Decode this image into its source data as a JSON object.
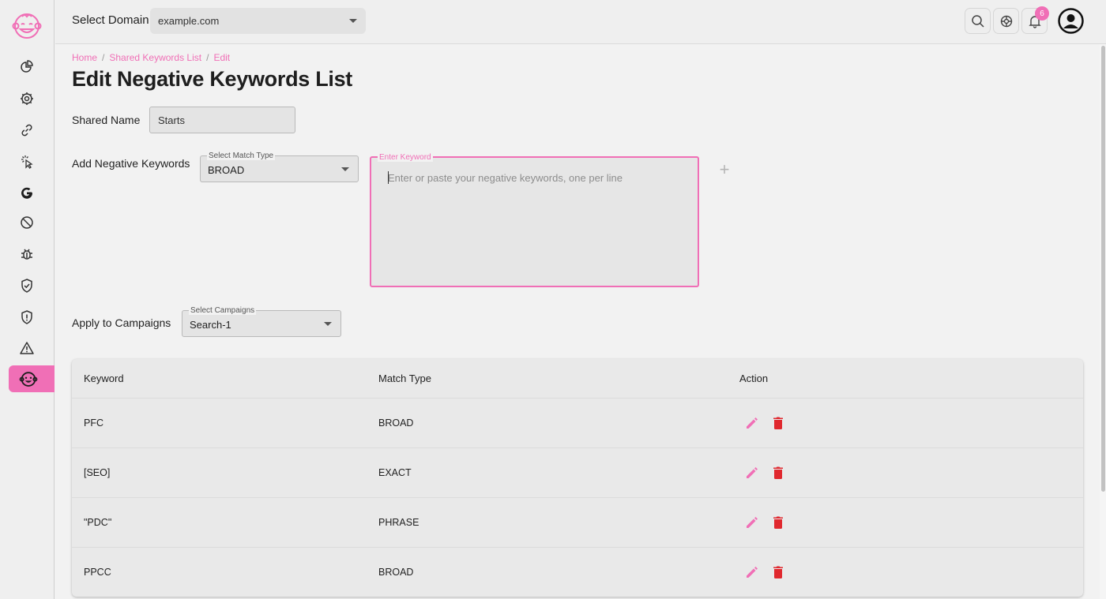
{
  "topbar": {
    "domain_label": "Select Domain",
    "domain_value": "example.com",
    "notification_count": "6"
  },
  "sidebar": {
    "items": [
      {
        "icon": "pie-chart-icon"
      },
      {
        "icon": "settings-gear-icon"
      },
      {
        "icon": "link-icon"
      },
      {
        "icon": "click-cursor-icon"
      },
      {
        "icon": "google-icon"
      },
      {
        "icon": "block-icon"
      },
      {
        "icon": "bug-icon"
      },
      {
        "icon": "shield-check-icon"
      },
      {
        "icon": "shield-alert-icon"
      },
      {
        "icon": "warning-icon"
      },
      {
        "icon": "monkey-face-icon",
        "active": true
      }
    ]
  },
  "breadcrumb": {
    "home": "Home",
    "list": "Shared Keywords List",
    "current": "Edit",
    "separator": "/"
  },
  "page": {
    "title": "Edit Negative Keywords List"
  },
  "form": {
    "shared_name_label": "Shared Name",
    "shared_name_value": "Starts",
    "add_keywords_label": "Add Negative Keywords",
    "match_type_legend": "Select Match Type",
    "match_type_value": "BROAD",
    "keyword_legend": "Enter Keyword",
    "keyword_placeholder": "Enter or paste your negative keywords, one per line",
    "add_symbol": "+",
    "apply_label": "Apply to Campaigns",
    "campaigns_legend": "Select Campaigns",
    "campaigns_value": "Search-1"
  },
  "table": {
    "headers": {
      "keyword": "Keyword",
      "match_type": "Match Type",
      "action": "Action"
    },
    "rows": [
      {
        "keyword": "PFC",
        "match_type": "BROAD"
      },
      {
        "keyword": "[SEO]",
        "match_type": "EXACT"
      },
      {
        "keyword": "\"PDC\"",
        "match_type": "PHRASE"
      },
      {
        "keyword": "PPCC",
        "match_type": "BROAD"
      }
    ]
  },
  "colors": {
    "accent": "#f06fb6",
    "delete": "#e0282e",
    "background": "#f2f2f2"
  }
}
